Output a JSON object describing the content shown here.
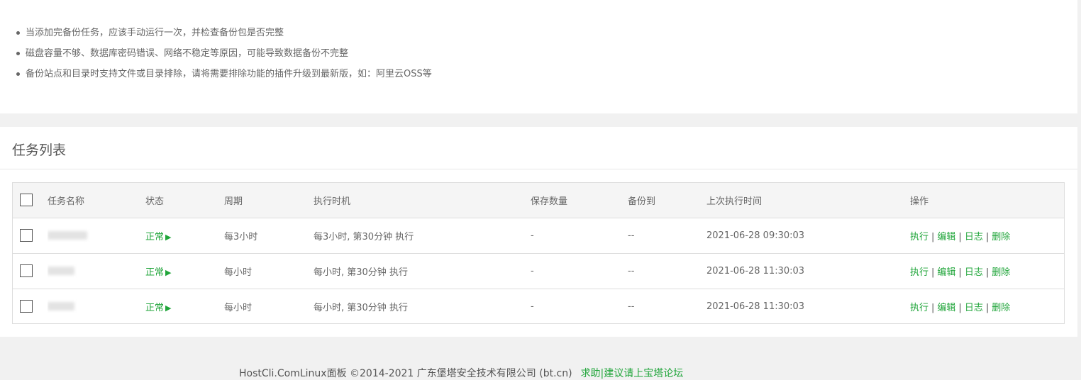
{
  "tips": [
    "当添加完备份任务，应该手动运行一次，并检查备份包是否完整",
    "磁盘容量不够、数据库密码错误、网络不稳定等原因，可能导致数据备份不完整",
    "备份站点和目录时支持文件或目录排除，请将需要排除功能的插件升级到最新版，如：阿里云OSS等"
  ],
  "task_list": {
    "title": "任务列表",
    "columns": [
      "任务名称",
      "状态",
      "周期",
      "执行时机",
      "保存数量",
      "备份到",
      "上次执行时间",
      "操作"
    ],
    "rows": [
      {
        "name": "",
        "status": "正常",
        "period": "每3小时",
        "timing": "每3小时, 第30分钟 执行",
        "keep": "-",
        "backup_to": "--",
        "last_run": "2021-06-28 09:30:03"
      },
      {
        "name": "",
        "status": "正常",
        "period": "每小时",
        "timing": "每小时, 第30分钟 执行",
        "keep": "-",
        "backup_to": "--",
        "last_run": "2021-06-28 11:30:03"
      },
      {
        "name": "",
        "status": "正常",
        "period": "每小时",
        "timing": "每小时, 第30分钟 执行",
        "keep": "-",
        "backup_to": "--",
        "last_run": "2021-06-28 11:30:03"
      }
    ],
    "actions": {
      "run": "执行",
      "edit": "编辑",
      "log": "日志",
      "delete": "删除",
      "separator": "|"
    },
    "status_icon": "play-icon"
  },
  "footer": {
    "copyright": "HostCli.ComLinux面板 ©2014-2021 广东堡塔安全技术有限公司 (bt.cn)",
    "link": "求助|建议请上宝塔论坛"
  },
  "colors": {
    "accent": "#20a53a",
    "background": "#f1f1f1"
  }
}
